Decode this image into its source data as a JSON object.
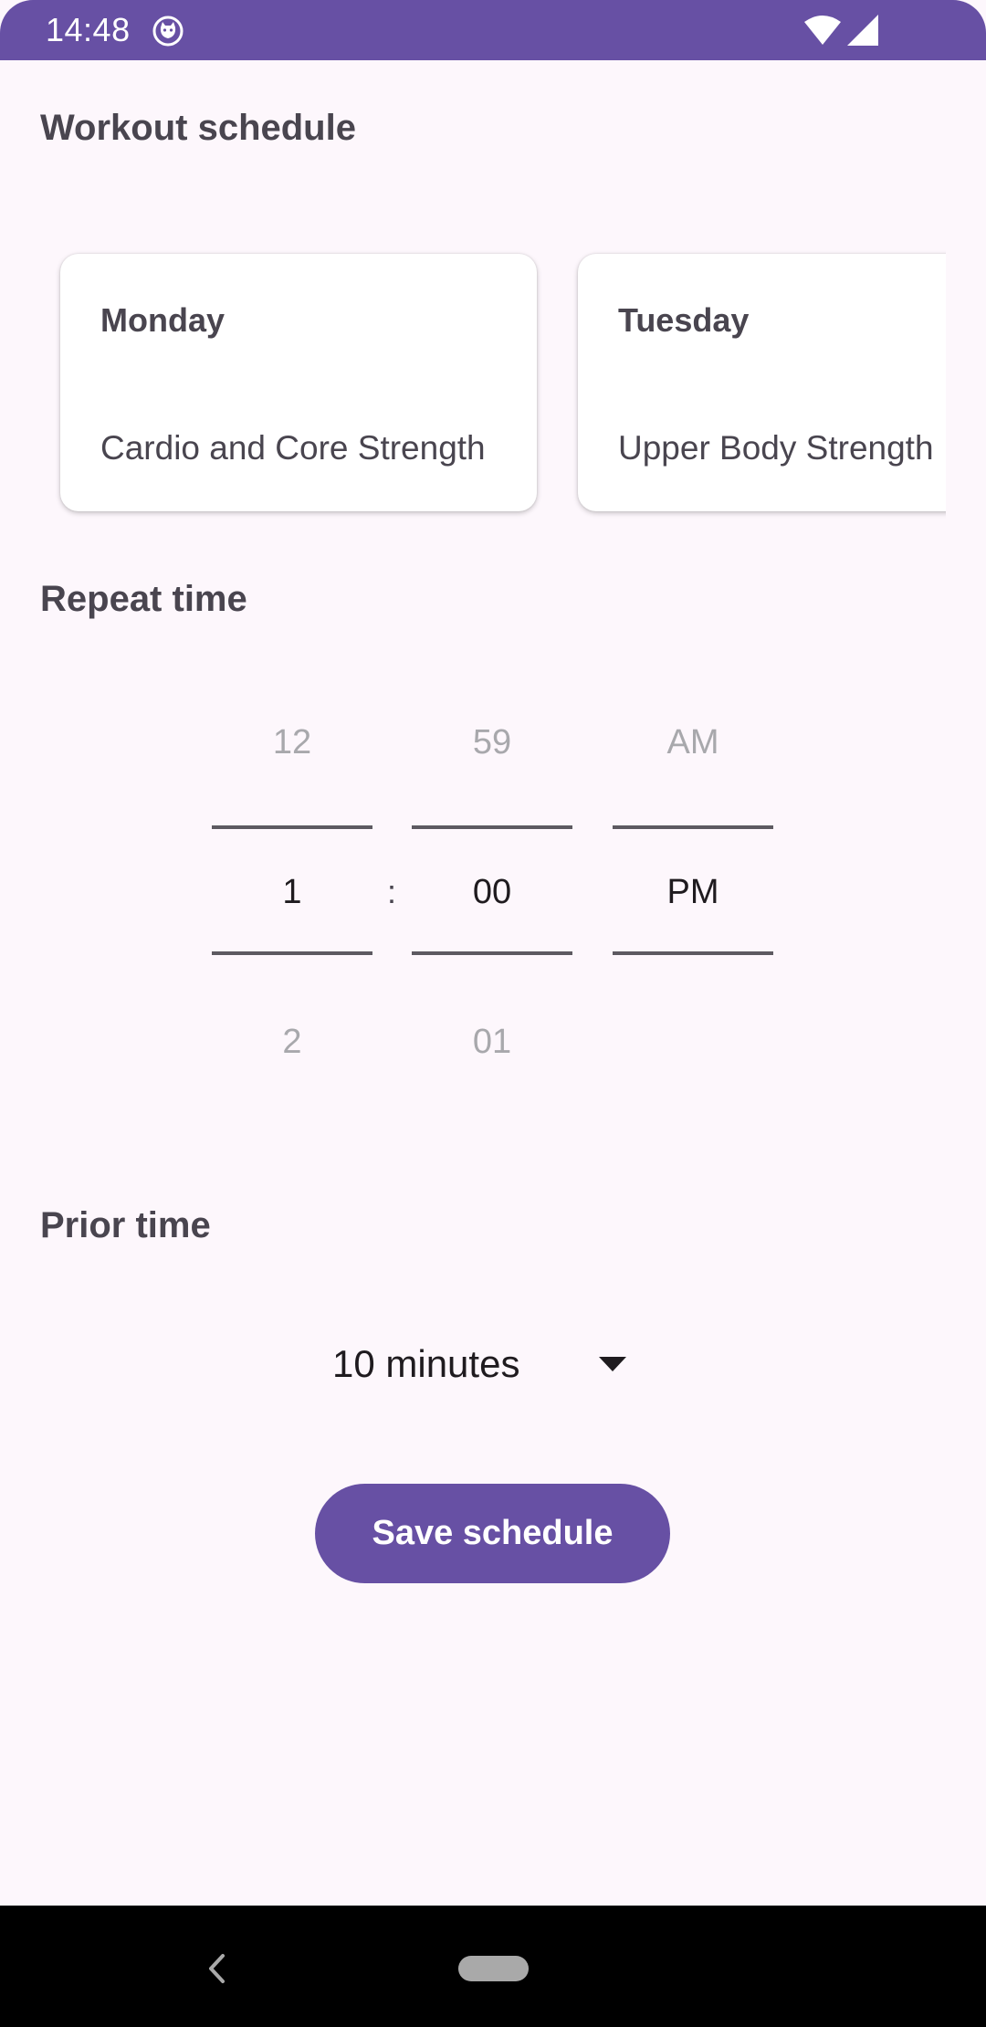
{
  "status_bar": {
    "time": "14:48",
    "icons": [
      "cat-icon",
      "wifi-icon",
      "signal-icon"
    ]
  },
  "workout_schedule": {
    "title": "Workout schedule",
    "cards": [
      {
        "day": "Monday",
        "description": "Cardio and Core Strength"
      },
      {
        "day": "Tuesday",
        "description": "Upper Body Strength"
      }
    ]
  },
  "repeat_time": {
    "title": "Repeat time",
    "hour": {
      "prev": "12",
      "selected": "1",
      "next": "2"
    },
    "separator": ":",
    "minute": {
      "prev": "59",
      "selected": "00",
      "next": "01"
    },
    "period": {
      "prev": "AM",
      "selected": "PM",
      "next": ""
    }
  },
  "prior_time": {
    "title": "Prior time",
    "selected": "10 minutes",
    "icon": "dropdown-arrow-icon"
  },
  "save_button": {
    "label": "Save schedule"
  },
  "colors": {
    "primary": "#6750a4",
    "background": "#fdf7fc",
    "text": "#49454f",
    "dim_text": "#a8a8ac"
  },
  "nav_bar": {
    "icons": [
      "back-icon",
      "home-pill"
    ]
  }
}
